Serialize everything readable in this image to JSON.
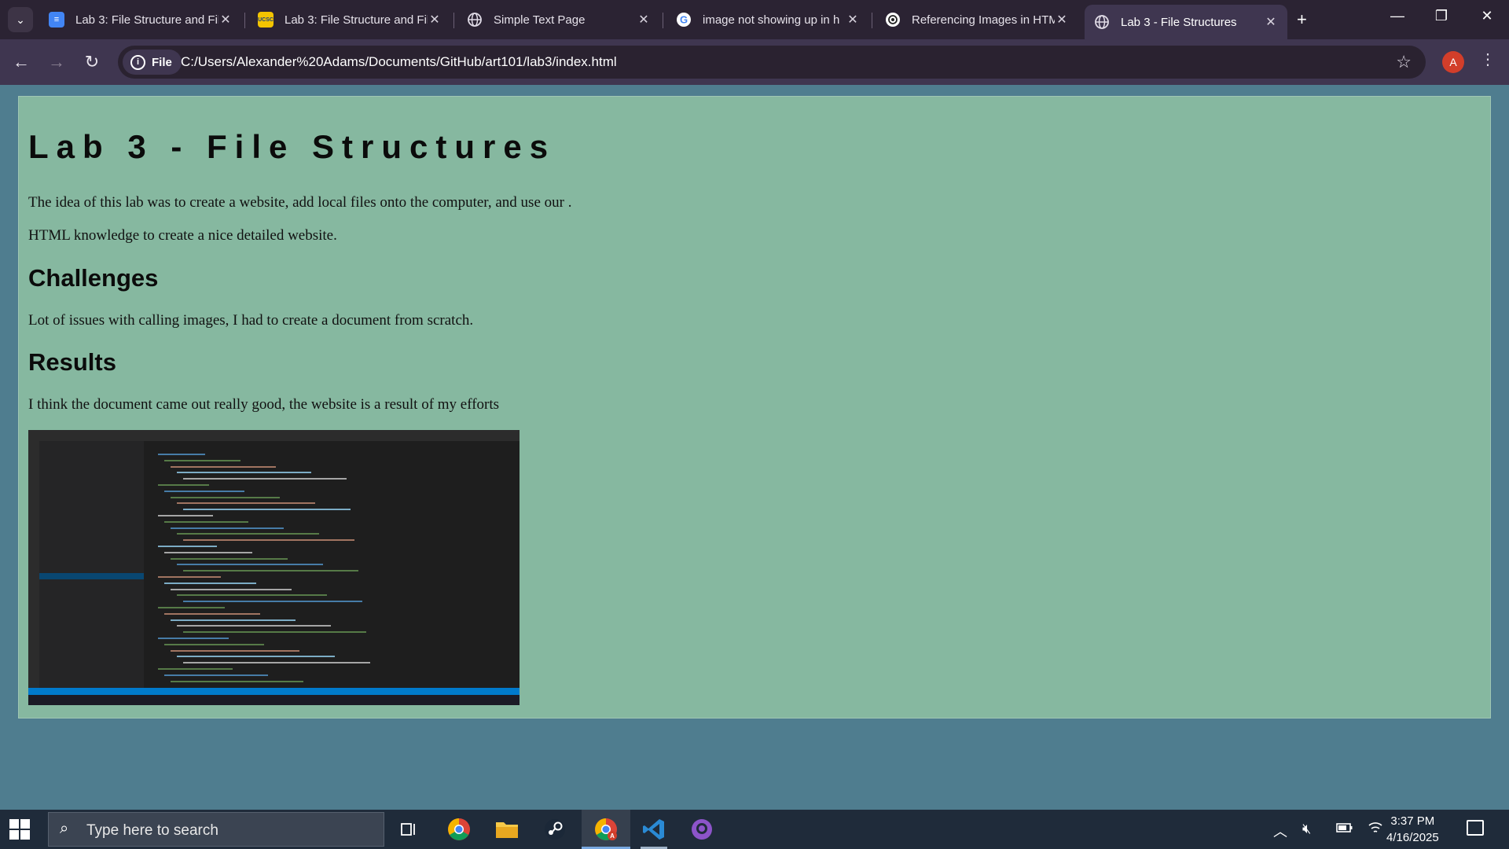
{
  "browser": {
    "tabs": [
      {
        "title": "Lab 3: File Structure and Fil",
        "icon": "docs-icon",
        "color": "#4285f4"
      },
      {
        "title": "Lab 3: File Structure and Fil",
        "icon": "ucsc-icon",
        "color": "#f3c400",
        "glyph": "UCSC"
      },
      {
        "title": "Simple Text Page",
        "icon": "globe-icon"
      },
      {
        "title": "image not showing up in h",
        "icon": "google-icon"
      },
      {
        "title": "Referencing Images in HTM",
        "icon": "openai-icon"
      },
      {
        "title": "Lab 3 - File Structures",
        "icon": "globe-icon",
        "active": true
      }
    ],
    "address": {
      "scheme_chip": "File",
      "url": "C:/Users/Alexander%20Adams/Documents/GitHub/art101/lab3/index.html"
    },
    "profile_initial": "A"
  },
  "page": {
    "title": "Lab 3 - File Structures",
    "intro_1": "The idea of this lab was to create a website, add local files onto the computer, and use our .",
    "intro_2": "HTML knowledge to create a nice detailed website.",
    "challenges_heading": "Challenges",
    "challenges_text": "Lot of issues with calling images, I had to create a document from scratch.",
    "results_heading": "Results",
    "results_text": "I think the document came out really good, the website is a result of my efforts"
  },
  "taskbar": {
    "search_placeholder": "Type here to search",
    "time": "3:37 PM",
    "date": "4/16/2025"
  },
  "colors": {
    "page_bg": "#4f7d8f",
    "card_bg": "#86b8a0",
    "tab_strip": "#2b2333",
    "toolbar": "#3f3650"
  }
}
